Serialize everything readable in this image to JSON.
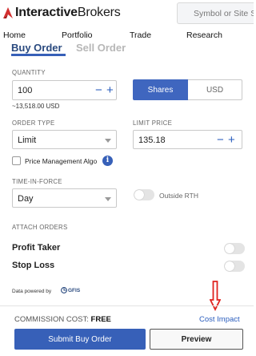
{
  "header": {
    "logo_bold": "Interactive",
    "logo_regular": "Brokers",
    "search_placeholder": "Symbol or Site S"
  },
  "nav": {
    "items": [
      {
        "label": "Home"
      },
      {
        "label": "Portfolio"
      },
      {
        "label": "Trade"
      },
      {
        "label": "Research"
      }
    ]
  },
  "order_tabs": {
    "buy": "Buy Order",
    "sell": "Sell Order",
    "active": "buy"
  },
  "quantity": {
    "label": "QUANTITY",
    "value": "100",
    "estimate": "~13,518.00 USD",
    "unit_options": [
      "Shares",
      "USD"
    ],
    "unit_selected": "Shares"
  },
  "order_type": {
    "label": "ORDER TYPE",
    "value": "Limit"
  },
  "limit_price": {
    "label": "LIMIT PRICE",
    "value": "135.18"
  },
  "price_management": {
    "label": "Price Management Algo",
    "checked": false,
    "info_icon": "i"
  },
  "time_in_force": {
    "label": "TIME-IN-FORCE",
    "value": "Day"
  },
  "outside_rth": {
    "label": "Outside RTH",
    "on": false
  },
  "attach_orders": {
    "label": "ATTACH ORDERS",
    "profit_taker": {
      "label": "Profit Taker",
      "on": false
    },
    "stop_loss": {
      "label": "Stop Loss",
      "on": false
    }
  },
  "data_source": {
    "label": "Data powered by",
    "provider": "GFIS"
  },
  "commission": {
    "label": "COMMISSION COST:",
    "value": "FREE"
  },
  "cost_impact": "Cost Impact",
  "buttons": {
    "submit": "Submit Buy Order",
    "preview": "Preview"
  },
  "colors": {
    "brand_blue": "#3760b8",
    "link_blue": "#2a5dbd",
    "logo_red": "#d32f2f",
    "arrow_red": "#e0231f"
  }
}
